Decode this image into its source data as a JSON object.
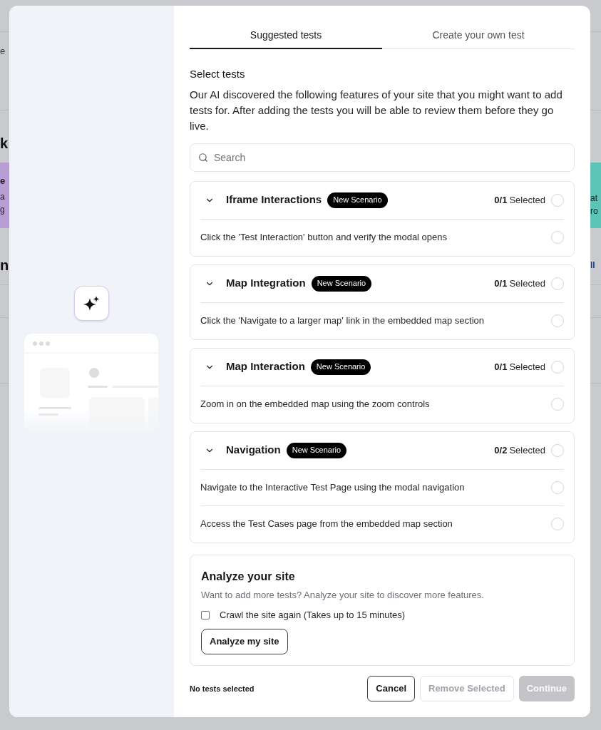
{
  "backdrop": {
    "left_fragments": [
      "e",
      "k",
      "e",
      "a",
      "g",
      "n"
    ],
    "right_fragments": [
      "at",
      "ro",
      "ll"
    ]
  },
  "tabs": [
    {
      "label": "Suggested tests",
      "selected": true
    },
    {
      "label": "Create your own test",
      "selected": false
    }
  ],
  "heading": "Select tests",
  "intro": "Our AI discovered the following features of your site that you might want to add tests for. After adding the tests you will be able to review them before they go live.",
  "search": {
    "placeholder": "Search"
  },
  "groups": [
    {
      "title": "Iframe Interactions",
      "badge": "New Scenario",
      "count": "0/1",
      "count_label": "Selected",
      "checked": false,
      "expanded": true,
      "tests": [
        {
          "label": "Click the 'Test Interaction' button and verify the modal opens",
          "checked": false
        }
      ]
    },
    {
      "title": "Map Integration",
      "badge": "New Scenario",
      "count": "0/1",
      "count_label": "Selected",
      "checked": false,
      "expanded": true,
      "tests": [
        {
          "label": "Click the 'Navigate to a larger map' link in the embedded map section",
          "checked": false
        }
      ]
    },
    {
      "title": "Map Interaction",
      "badge": "New Scenario",
      "count": "0/1",
      "count_label": "Selected",
      "checked": false,
      "expanded": true,
      "tests": [
        {
          "label": "Zoom in on the embedded map using the zoom controls",
          "checked": false
        }
      ]
    },
    {
      "title": "Navigation",
      "badge": "New Scenario",
      "count": "0/2",
      "count_label": "Selected",
      "checked": false,
      "expanded": true,
      "tests": [
        {
          "label": "Navigate to the Interactive Test Page using the modal navigation",
          "checked": false
        },
        {
          "label": "Access the Test Cases page from the embedded map section",
          "checked": false
        }
      ]
    }
  ],
  "analyze": {
    "title": "Analyze your site",
    "description": "Want to add more tests? Analyze your site to discover more features.",
    "crawl": {
      "label": "Crawl the site again (Takes up to 15 minutes)",
      "checked": false
    },
    "button": "Analyze my site"
  },
  "footer": {
    "status": "No tests selected",
    "buttons": [
      {
        "label": "Cancel",
        "kind": "outline",
        "disabled": false
      },
      {
        "label": "Remove Selected",
        "kind": "outline",
        "disabled": true
      },
      {
        "label": "Continue",
        "kind": "primary",
        "disabled": true
      }
    ]
  }
}
